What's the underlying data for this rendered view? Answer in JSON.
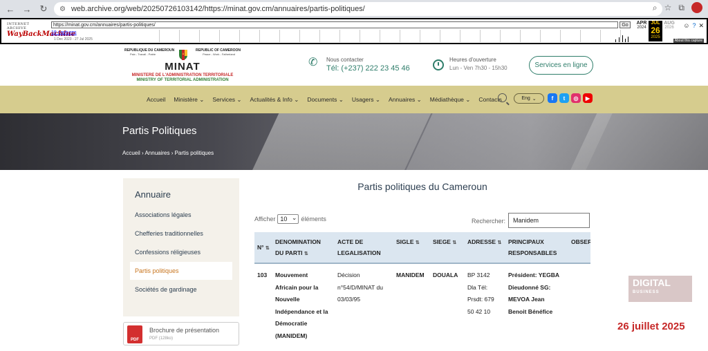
{
  "browser": {
    "url": "web.archive.org/web/20250726103142/https://minat.gov.cm/annuaires/partis-politiques/"
  },
  "wayback": {
    "logo_top": "INTERNET ARCHIVE",
    "logo_main": "WayBackMachine",
    "url": "https://minat.gov.cm/annuaires/partis-politiques/",
    "go": "Go",
    "captures": "18 captures",
    "range": "1 Dec 2023 - 27 Jul 2025",
    "months": [
      {
        "m": "APR",
        "d": "",
        "y": "2024"
      },
      {
        "m": "JUL",
        "d": "26",
        "y": "2025"
      },
      {
        "m": "AUG",
        "d": "",
        "y": "2026"
      }
    ],
    "about": "About this capture"
  },
  "header": {
    "rep_fr": "REPUBLIQUE DU CAMEROUN",
    "motto_fr": "Paix - Travail - Patrie",
    "rep_en": "REPUBLIC OF CAMEROON",
    "motto_en": "Peace - Work - Fatherland",
    "minat": "MINAT",
    "ministry_fr": "MINISTERE DE L'ADMINISTRATION TERRITORIALE",
    "ministry_en": "MINISTRY OF TERRITORIAL ADMINISTRATION",
    "contact_label": "Nous contacter",
    "contact_value": "Tél: (+237) 222 23 45 46",
    "hours_label": "Heures d'ouverture",
    "hours_value": "Lun - Ven 7h30 - 15h30",
    "services_button": "Services en ligne"
  },
  "nav": {
    "items": [
      "Accueil",
      "Ministère ⌄",
      "Services ⌄",
      "Actualités & Info ⌄",
      "Documents ⌄",
      "Usagers ⌄",
      "Annuaires ⌄",
      "Médiathèque ⌄",
      "Contacts"
    ],
    "lang": "Eng"
  },
  "hero": {
    "title": "Partis Politiques",
    "breadcrumb": "Accueil  ›  Annuaires  ›  Partis politiques"
  },
  "sidebar": {
    "heading": "Annuaire",
    "items": [
      "Associations légales",
      "Chefferies traditionnelles",
      "Confessions réligieuses",
      "Partis politiques",
      "Sociétés de gardinage"
    ],
    "brochure_title": "Brochure de présentation",
    "brochure_sub": "PDF (128ko)"
  },
  "main": {
    "title": "Partis politiques du Cameroun",
    "show_prefix": "Afficher",
    "show_value": "10",
    "show_suffix": "éléments",
    "search_label": "Rechercher:",
    "search_value": "Manidem",
    "columns": [
      "N°",
      "DENOMINATION DU PARTI",
      "ACTE DE LEGALISATION",
      "SIGLE",
      "SIEGE",
      "ADRESSE",
      "PRINCIPAUX RESPONSABLES",
      "OBSER"
    ],
    "row": {
      "num": "103",
      "denomination": [
        "Mouvement",
        "Africain pour la",
        "Nouvelle",
        "Indépendance et la",
        "Démocratie",
        "(MANIDEM)"
      ],
      "acte": [
        "Décision",
        "n°54/D/MINAT du",
        "03/03/95"
      ],
      "sigle": "MANIDEM",
      "siege": "DOUALA",
      "adresse": [
        "BP 3142",
        "Dla Tél:",
        "Prsdt: 679",
        "50 42 10"
      ],
      "responsables": [
        "Président: YEGBA",
        "Dieudonné SG:",
        "MEVOA Jean",
        "Benoit Bénéfice"
      ]
    }
  },
  "overlay": {
    "watermark_main": "DIGITAL",
    "watermark_sub": "BUSINESS",
    "date": "26 juillet 2025"
  },
  "colors": {
    "nav_bg": "#d6cc8e",
    "accent_green": "#2e7d6a",
    "active_orange": "#c8751e",
    "table_head": "#dbe6f0"
  }
}
